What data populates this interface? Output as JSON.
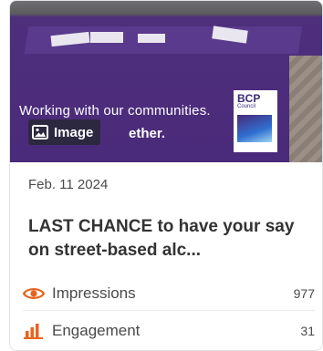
{
  "post": {
    "image_tag_label": "Image",
    "banner_line1": "Working with our communities.",
    "banner_line2": "ether.",
    "logo_text": "BCP",
    "logo_sub": "Council",
    "date": "Feb. 11 2024",
    "title": "LAST CHANCE to have your say on street-based alc..."
  },
  "metrics": {
    "impressions": {
      "label": "Impressions",
      "value": "977",
      "icon": "eye-icon"
    },
    "engagement": {
      "label": "Engagement",
      "value": "31",
      "icon": "bar-chart-icon"
    }
  },
  "colors": {
    "accent": "#e8641e",
    "banner_purple": "#4a2a7a"
  }
}
